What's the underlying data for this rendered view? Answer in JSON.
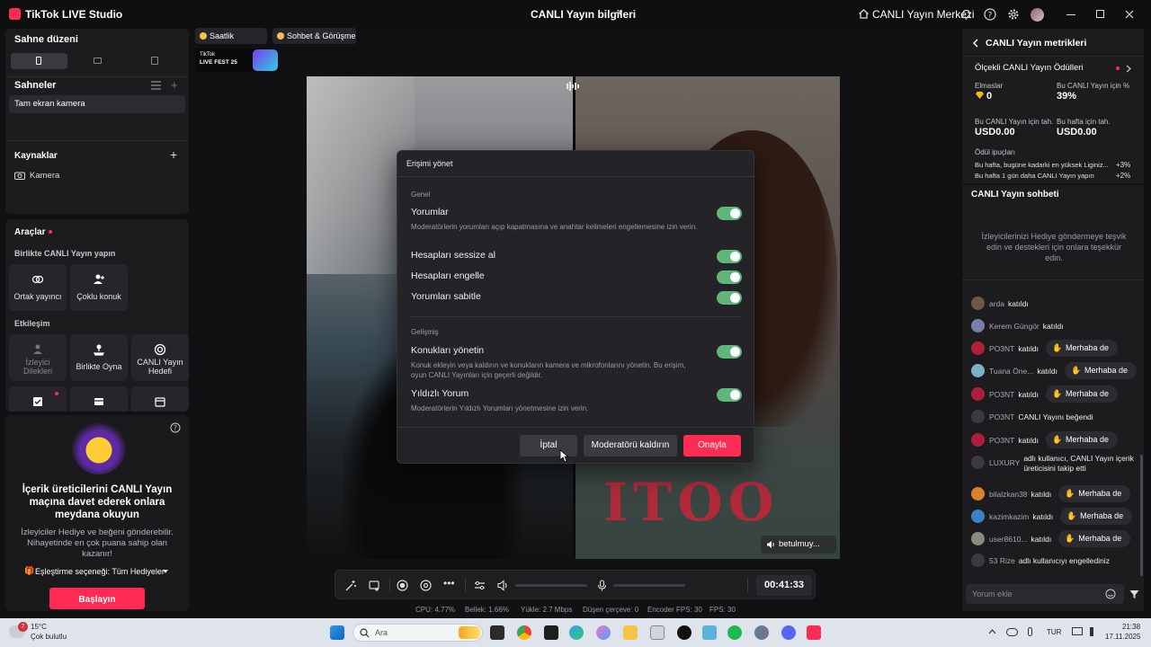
{
  "window": {
    "app_title": "TikTok LIVE Studio",
    "center_title": "CANLI Yayın bilgileri",
    "live_center_label": "CANLI Yayın Merkezi"
  },
  "left": {
    "scene_layout": {
      "title": "Sahne düzeni"
    },
    "scenes": {
      "title": "Sahneler",
      "items": [
        "Tam ekran kamera"
      ]
    },
    "sources": {
      "title": "Kaynaklar",
      "items": [
        "Kamera"
      ]
    },
    "tools": {
      "title": "Araçlar",
      "group1_title": "Birlikte CANLI Yayın yapın",
      "group1": [
        "Ortak yayıncı",
        "Çoklu konuk"
      ],
      "group2_title": "Etkileşim",
      "group2": [
        {
          "label": "İzleyici Dilekleri",
          "disabled": true
        },
        {
          "label": "Birlikte Oyna",
          "disabled": false
        },
        {
          "label": "CANLI Yayın Hedefi",
          "disabled": false
        }
      ]
    },
    "promo": {
      "title": "İçerik üreticilerini CANLI Yayın maçına davet ederek onlara meydana okuyun",
      "text": "İzleyiciler Hediye ve beğeni gönderebilir. Nihayetinde en çok puana sahip olan kazanır!",
      "pairing": "Eşleştirme seçeneği: Tüm Hediyeler",
      "button": "Başlayın"
    }
  },
  "stage": {
    "chips": [
      "Saatlik Sıralama",
      "Sohbet & Görüşme"
    ],
    "fest_badge": {
      "line1": "TikTok",
      "line2": "LIVE FEST 25"
    },
    "guest_name": "betulmuy..."
  },
  "modal": {
    "title": "Erişimi yönet",
    "section_general": "Genel",
    "options_general": [
      {
        "label": "Yorumlar",
        "desc": "Moderatörlerin yorumları açıp kapatmasına ve anahtar kelimeleri engellemesine izin verin.",
        "on": true
      },
      {
        "label": "Hesapları sessize al",
        "desc": "",
        "on": true
      },
      {
        "label": "Hesapları engelle",
        "desc": "",
        "on": true
      },
      {
        "label": "Yorumları sabitle",
        "desc": "",
        "on": true
      }
    ],
    "section_advanced": "Gelişmiş",
    "options_advanced": [
      {
        "label": "Konukları yönetin",
        "desc": "Konuk ekleyin veya kaldırın ve konukların kamera ve mikrofonlarını yönetin. Bu erişim, oyun CANLI Yayınları için geçerli değildir.",
        "on": true
      },
      {
        "label": "Yıldızlı Yorum",
        "desc": "Moderatörlerin Yıldızlı Yorumları yönetmesine izin verin.",
        "on": true
      }
    ],
    "buttons": {
      "cancel": "İptal",
      "remove": "Moderatörü kaldırın",
      "confirm": "Onayla"
    }
  },
  "controls": {
    "timer": "00:41:33",
    "volume_level": 0.0,
    "mic_level": 0.0
  },
  "stats": {
    "cpu": "CPU:  4.77%",
    "memory": "Bellek:  1.66%",
    "upload": "Yükle:  2.7 Mbps",
    "dropped": "Düşen çerçeve:  0",
    "encoder": "Encoder FPS:  30",
    "fps": "FPS:  30"
  },
  "metrics": {
    "title": "CANLI Yayın metrikleri",
    "rewards_title": "Ölçekli CANLI Yayın Ödülleri",
    "diamonds_label": "Elmaslar",
    "diamonds_value": "0",
    "pct_label": "Bu CANLI Yayın için %",
    "pct_value": "39%",
    "est_live_label": "Bu CANLI Yayın için tah.",
    "est_live_value": "USD0.00",
    "est_week_label": "Bu hafta için tah.",
    "est_week_value": "USD0.00",
    "tips_title": "Ödül ipuçları",
    "tips": [
      {
        "text": "Bu hafta, bugüne kadarki en yüksek Liginiz...",
        "pct": "+3%"
      },
      {
        "text": "Bu hafta 1 gün daha CANLI Yayın yapın",
        "pct": "+2%"
      }
    ]
  },
  "chat": {
    "title": "CANLI Yayın sohbeti",
    "hint": "İzleyicilerinizi Hediye göndermeye teşvik edin ve destekleri için onlara teşekkür edin.",
    "wave_label": "Merhaba de",
    "messages": [
      {
        "user": "arda",
        "action": "katıldı",
        "wave": false,
        "color": "#6a5a4e"
      },
      {
        "user": "Kerem Güngör",
        "action": "katıldı",
        "wave": false,
        "color": "#7a7fa8"
      },
      {
        "user": "PO3NT",
        "action": "katıldı",
        "wave": true,
        "color": "#b01e3e"
      },
      {
        "user": "Tuana Öne...",
        "action": "katıldı",
        "wave": true,
        "color": "#7ab0c8"
      },
      {
        "user": "PO3NT",
        "action": "katıldı",
        "wave": true,
        "color": "#b01e3e"
      },
      {
        "user": "PO3NT",
        "action": "CANLI Yayını beğendi",
        "wave": false,
        "color": "#3a3a40"
      },
      {
        "user": "PO3NT",
        "action": "katıldı",
        "wave": true,
        "color": "#b01e3e"
      },
      {
        "user": "LUXURY",
        "action": "adlı kullanıcı, CANLI Yayın içerik üreticisini takip etti",
        "wave": false,
        "color": "#3a3a40"
      },
      {
        "user": "bilalzkan38",
        "action": "katıldı",
        "wave": true,
        "color": "#d9822b"
      },
      {
        "user": "kazimkazim",
        "action": "katıldı",
        "wave": true,
        "color": "#3b82c4"
      },
      {
        "user": "user8610...",
        "action": "katıldı",
        "wave": true,
        "color": "#8a8a80"
      },
      {
        "user": "53 Rize",
        "action": "adlı kullanıcıyı engellediniz",
        "wave": false,
        "color": "#3a3a40"
      }
    ],
    "input_placeholder": "Yorum ekle"
  },
  "taskbar": {
    "weather_temp": "15°C",
    "weather_text": "Çok bulutlu",
    "weather_badge": "7",
    "search": "Ara",
    "lang": "TUR",
    "time": "21:38",
    "date": "17.11.2025"
  }
}
